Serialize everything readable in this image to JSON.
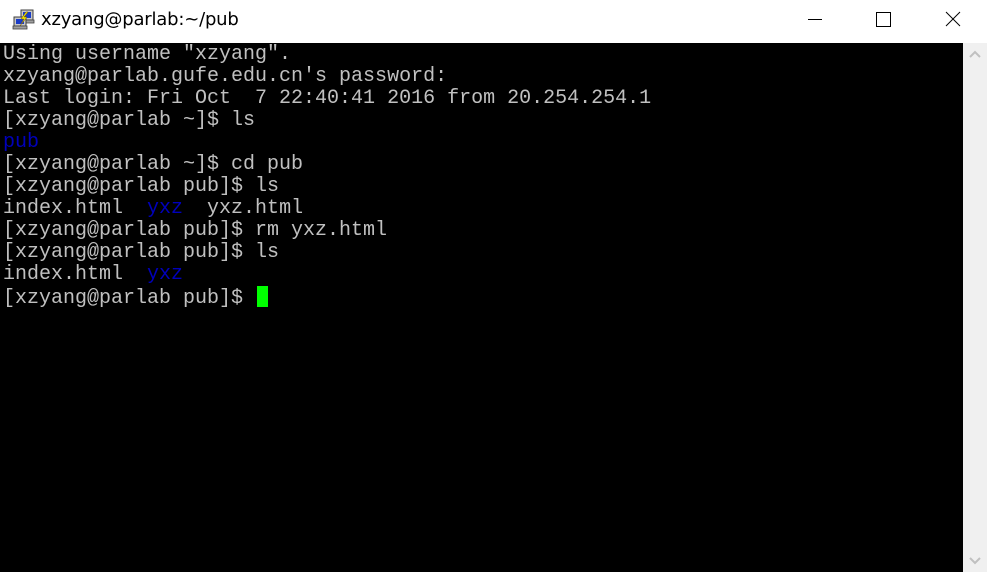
{
  "window": {
    "title": "xzyang@parlab:~/pub",
    "app_icon": "putty-icon",
    "controls": {
      "minimize": "minimize-icon",
      "maximize": "maximize-icon",
      "close": "close-icon"
    }
  },
  "terminal": {
    "colors": {
      "background": "#000000",
      "foreground": "#c0c0c0",
      "directory": "#0000bb",
      "cursor": "#00ff00"
    },
    "lines": [
      {
        "segments": [
          {
            "text": "Using username \"xzyang\".",
            "type": "text"
          }
        ]
      },
      {
        "segments": [
          {
            "text": "xzyang@parlab.gufe.edu.cn's password:",
            "type": "text"
          }
        ]
      },
      {
        "segments": [
          {
            "text": "Last login: Fri Oct  7 22:40:41 2016 from 20.254.254.1",
            "type": "text"
          }
        ]
      },
      {
        "segments": [
          {
            "text": "[xzyang@parlab ~]$ ls",
            "type": "text"
          }
        ]
      },
      {
        "segments": [
          {
            "text": "pub",
            "type": "dir"
          }
        ]
      },
      {
        "segments": [
          {
            "text": "[xzyang@parlab ~]$ cd pub",
            "type": "text"
          }
        ]
      },
      {
        "segments": [
          {
            "text": "[xzyang@parlab pub]$ ls",
            "type": "text"
          }
        ]
      },
      {
        "segments": [
          {
            "text": "index.html  ",
            "type": "text"
          },
          {
            "text": "yxz",
            "type": "dir"
          },
          {
            "text": "  yxz.html",
            "type": "text"
          }
        ]
      },
      {
        "segments": [
          {
            "text": "[xzyang@parlab pub]$ rm yxz.html",
            "type": "text"
          }
        ]
      },
      {
        "segments": [
          {
            "text": "[xzyang@parlab pub]$ ls",
            "type": "text"
          }
        ]
      },
      {
        "segments": [
          {
            "text": "index.html  ",
            "type": "text"
          },
          {
            "text": "yxz",
            "type": "dir"
          }
        ]
      },
      {
        "segments": [
          {
            "text": "[xzyang@parlab pub]$ ",
            "type": "text"
          }
        ],
        "cursor": true
      }
    ]
  },
  "scrollbar": {
    "up": "chevron-up-icon",
    "down": "chevron-down-icon"
  }
}
